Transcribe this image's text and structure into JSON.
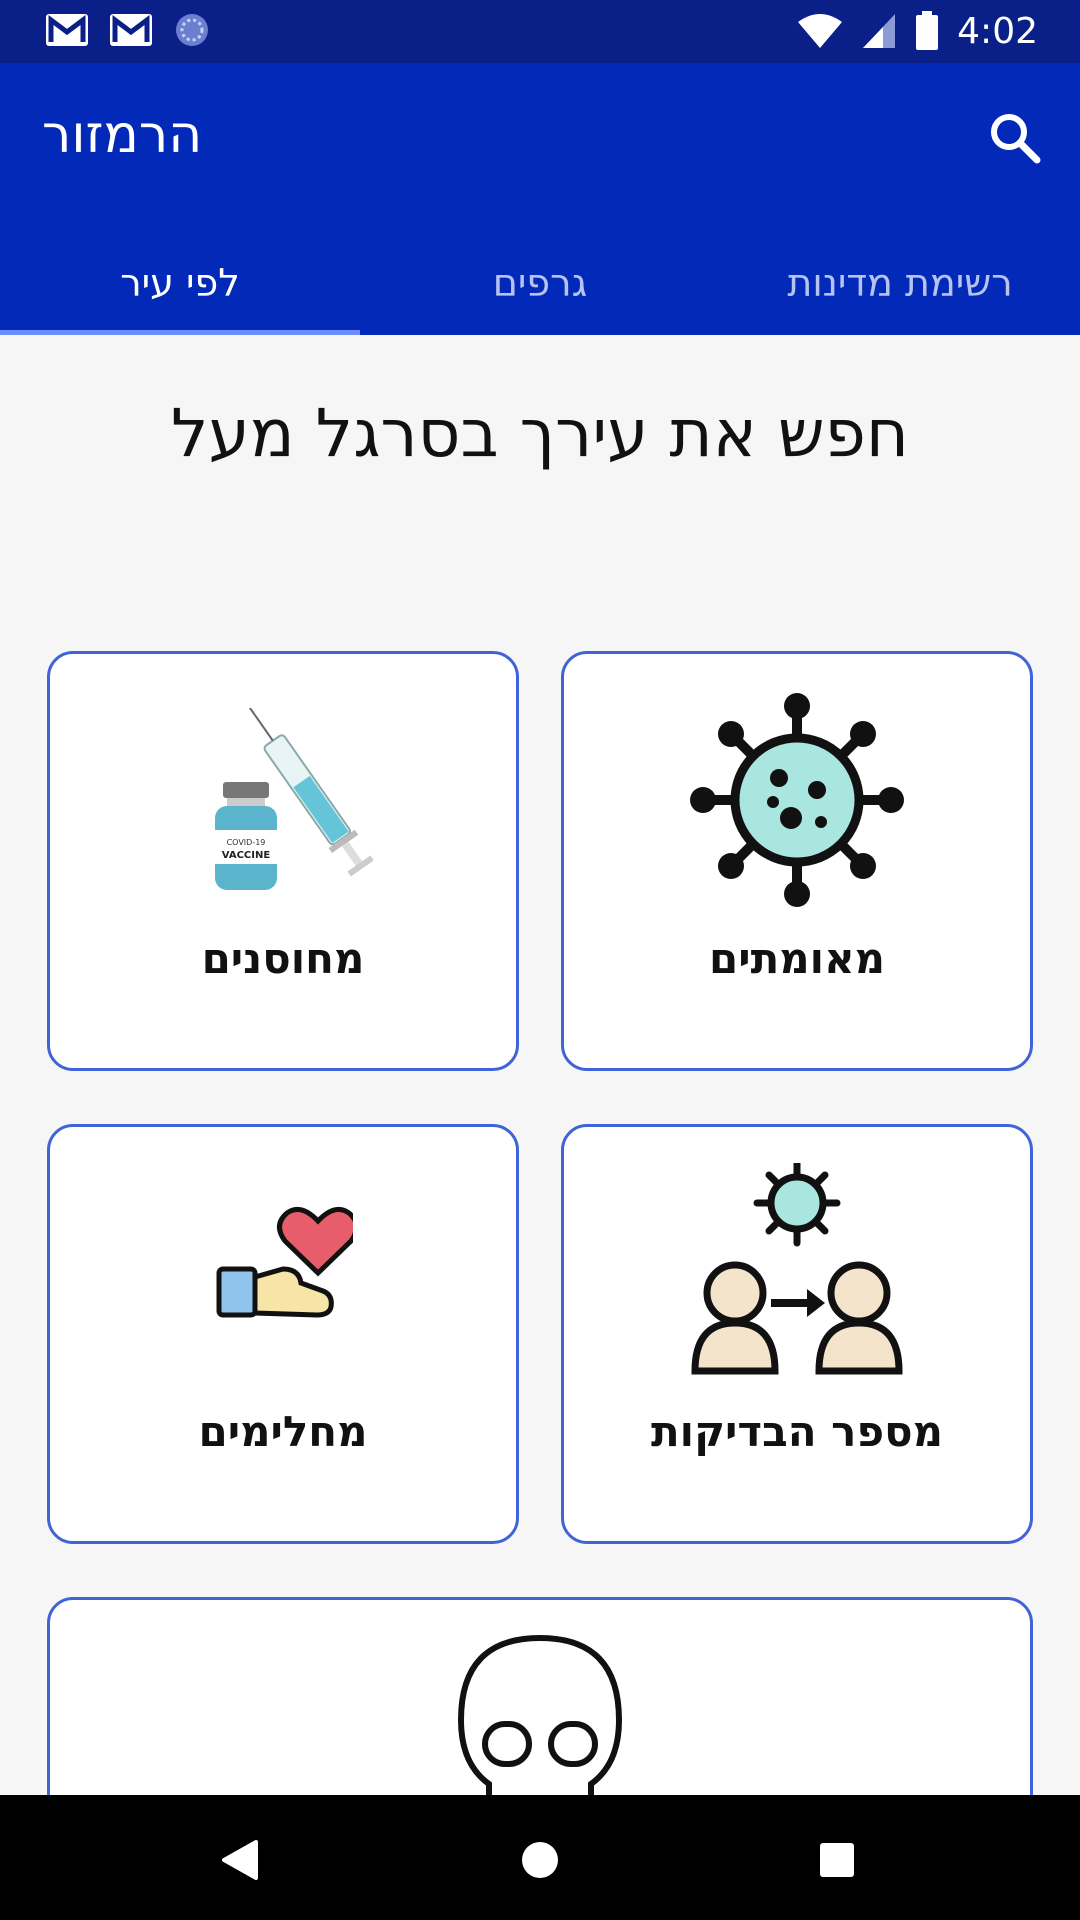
{
  "status_bar": {
    "time": "4:02",
    "left_icons": [
      "gmail-icon",
      "gmail-icon",
      "sync-icon"
    ],
    "right_icons": [
      "wifi-icon",
      "cell-signal-icon",
      "battery-icon"
    ]
  },
  "app_bar": {
    "title": "הרמזור",
    "search_icon": "search-icon",
    "background": "#0329b8"
  },
  "tabs": [
    {
      "label": "לפי עיר",
      "active": true
    },
    {
      "label": "גרפים",
      "active": false
    },
    {
      "label": "רשימת מדינות",
      "active": false
    }
  ],
  "headline": "חפש את עירך בסרגל מעל",
  "cards": [
    {
      "label": "מאומתים",
      "icon": "virus-icon"
    },
    {
      "label": "מחוסנים",
      "icon": "vaccine-icon"
    },
    {
      "label": "מספר הבדיקות",
      "icon": "transmission-icon"
    },
    {
      "label": "מחלימים",
      "icon": "heart-hand-icon"
    },
    {
      "label": "",
      "icon": "skull-icon"
    }
  ],
  "nav_bar": {
    "buttons": [
      "back-icon",
      "home-icon",
      "recents-icon"
    ]
  },
  "colors": {
    "status_bar": "#0a1f88",
    "card_border": "#4163d8",
    "active_tab_indicator": "#6d8dff"
  }
}
